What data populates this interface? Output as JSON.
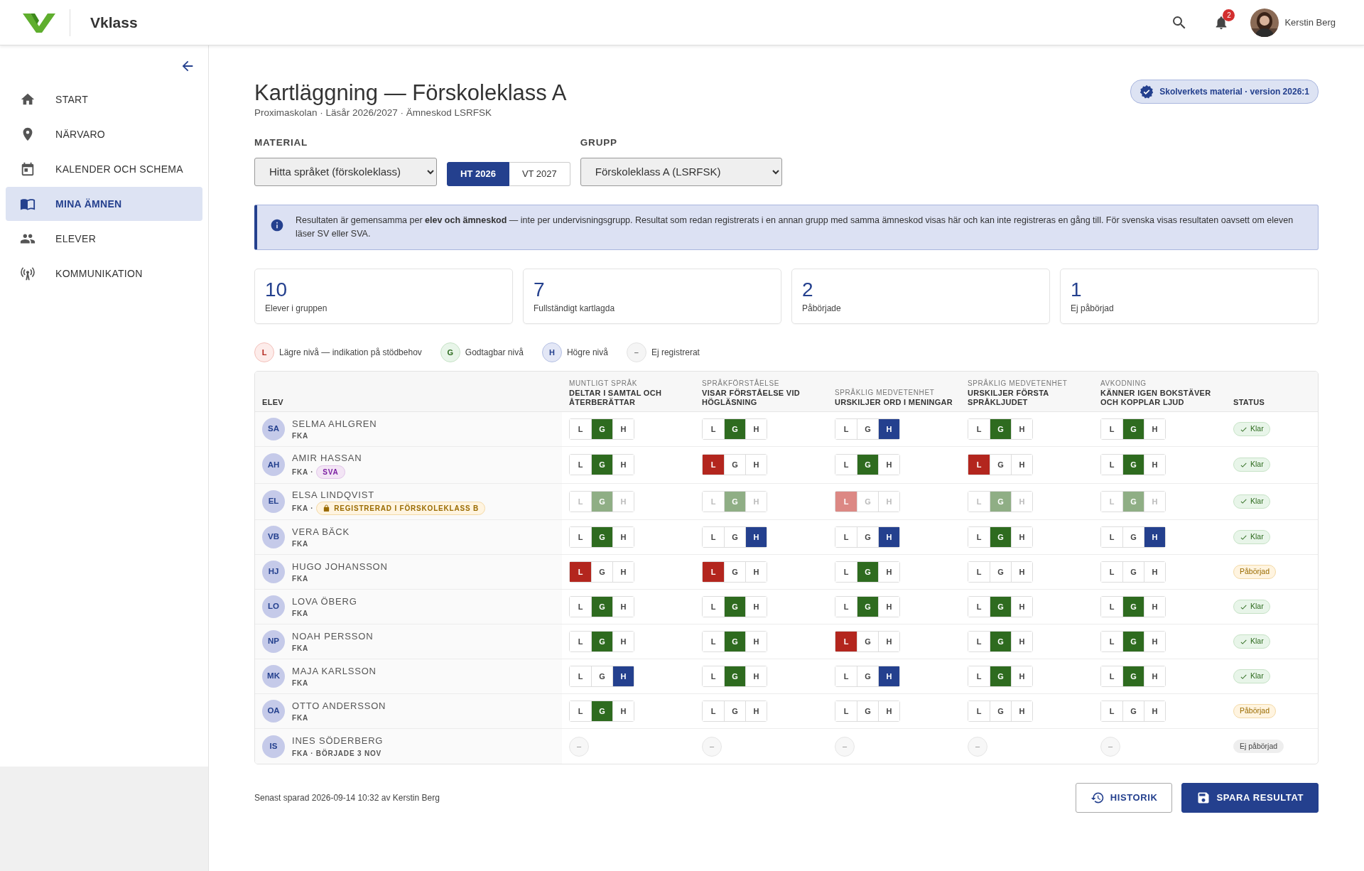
{
  "header": {
    "brand": "Vklass",
    "notifications": "2",
    "user": "Kerstin Berg"
  },
  "sidebar": {
    "items": [
      {
        "label": "START",
        "selected": false
      },
      {
        "label": "NÄRVARO",
        "selected": false
      },
      {
        "label": "KALENDER OCH SCHEMA",
        "selected": false
      },
      {
        "label": "MINA ÄMNEN",
        "selected": true
      },
      {
        "label": "ELEVER",
        "selected": false
      },
      {
        "label": "KOMMUNIKATION",
        "selected": false
      }
    ]
  },
  "page": {
    "title": "Kartläggning — Förskoleklass A",
    "subtitle": "Proximaskolan · Läsår 2026/2027 · Ämneskod LSRFSK",
    "badge": "Skolverkets material · version 2026:1"
  },
  "filters": {
    "material_label": "MATERIAL",
    "material": "Hitta språket (förskoleklass)",
    "terms": [
      {
        "label": "HT 2026",
        "selected": true
      },
      {
        "label": "VT 2027",
        "selected": false
      }
    ],
    "group_label": "GRUPP",
    "group": "Förskoleklass A (LSRFSK)"
  },
  "notice": "Resultaten är gemensamma per **elev och ämneskod** — inte per undervisningsgrupp. Resultat som redan registrerats i en annan grupp med samma ämneskod visas här och kan inte registreras en gång till. För svenska visas resultaten oavsett om eleven läser SV eller SVA.",
  "stats": [
    {
      "value": "10",
      "label": "Elever i gruppen"
    },
    {
      "value": "7",
      "label": "Fullständigt kartlagda"
    },
    {
      "value": "2",
      "label": "Påbörjade"
    },
    {
      "value": "1",
      "label": "Ej påbörjad"
    }
  ],
  "legend": [
    {
      "kind": "low",
      "symbol": "L",
      "text": "Lägre nivå — indikation på stödbehov"
    },
    {
      "kind": "ok",
      "symbol": "G",
      "text": "Godtagbar nivå"
    },
    {
      "kind": "high",
      "symbol": "H",
      "text": "Högre nivå"
    },
    {
      "kind": "none",
      "symbol": "–",
      "text": "Ej registrerat"
    }
  ],
  "table": {
    "columns": [
      {
        "title": "ELEV"
      },
      {
        "area": "MUNTLIGT SPRÅK",
        "title": "DELTAR I SAMTAL OCH ÅTERBERÄTTAR"
      },
      {
        "area": "SPRÅKFÖRSTÅELSE",
        "title": "VISAR FÖRSTÅELSE VID HÖGLÄSNING"
      },
      {
        "area": "SPRÅKLIG MEDVETENHET",
        "title": "URSKILJER ORD I MENINGAR"
      },
      {
        "area": "SPRÅKLIG MEDVETENHET",
        "title": "URSKILJER FÖRSTA SPRÅKLJUDET"
      },
      {
        "area": "AVKODNING",
        "title": "KÄNNER IGEN BOKSTÄVER OCH KOPPLAR LJUD"
      },
      {
        "title": "STATUS"
      }
    ],
    "rows": [
      {
        "initials": "SA",
        "name": "SELMA AHLGREN",
        "meta": "FKA",
        "grades": [
          {
            "options": [
              {
                "label": "L",
                "selected": false
              },
              {
                "label": "G",
                "selected": true
              },
              {
                "label": "H",
                "selected": false
              }
            ]
          },
          {
            "options": [
              {
                "label": "L",
                "selected": false
              },
              {
                "label": "G",
                "selected": true
              },
              {
                "label": "H",
                "selected": false
              }
            ]
          },
          {
            "options": [
              {
                "label": "L",
                "selected": false
              },
              {
                "label": "G",
                "selected": false
              },
              {
                "label": "H",
                "selected": true
              }
            ]
          },
          {
            "options": [
              {
                "label": "L",
                "selected": false
              },
              {
                "label": "G",
                "selected": true
              },
              {
                "label": "H",
                "selected": false
              }
            ]
          },
          {
            "options": [
              {
                "label": "L",
                "selected": false
              },
              {
                "label": "G",
                "selected": true
              },
              {
                "label": "H",
                "selected": false
              }
            ]
          }
        ],
        "status": {
          "kind": "done",
          "text": "Klar"
        }
      },
      {
        "initials": "AH",
        "name": "AMIR HASSAN",
        "meta": "FKA ·",
        "tag": {
          "kind": "sva",
          "text": "SVA"
        },
        "grades": [
          {
            "options": [
              {
                "label": "L",
                "selected": false
              },
              {
                "label": "G",
                "selected": true
              },
              {
                "label": "H",
                "selected": false
              }
            ]
          },
          {
            "options": [
              {
                "label": "L",
                "selected": true
              },
              {
                "label": "G",
                "selected": false
              },
              {
                "label": "H",
                "selected": false
              }
            ]
          },
          {
            "options": [
              {
                "label": "L",
                "selected": false
              },
              {
                "label": "G",
                "selected": true
              },
              {
                "label": "H",
                "selected": false
              }
            ]
          },
          {
            "options": [
              {
                "label": "L",
                "selected": true
              },
              {
                "label": "G",
                "selected": false
              },
              {
                "label": "H",
                "selected": false
              }
            ]
          },
          {
            "options": [
              {
                "label": "L",
                "selected": false
              },
              {
                "label": "G",
                "selected": true
              },
              {
                "label": "H",
                "selected": false
              }
            ]
          }
        ],
        "status": {
          "kind": "done",
          "text": "Klar"
        }
      },
      {
        "initials": "EL",
        "name": "ELSA LINDQVIST",
        "meta": "FKA ·",
        "tag": {
          "kind": "locked",
          "text": "REGISTRERAD I FÖRSKOLEKLASS B"
        },
        "locked": true,
        "grades": [
          {
            "options": [
              {
                "label": "L",
                "selected": false
              },
              {
                "label": "G",
                "selected": true
              },
              {
                "label": "H",
                "selected": false
              }
            ]
          },
          {
            "options": [
              {
                "label": "L",
                "selected": false
              },
              {
                "label": "G",
                "selected": true
              },
              {
                "label": "H",
                "selected": false
              }
            ]
          },
          {
            "options": [
              {
                "label": "L",
                "selected": true
              },
              {
                "label": "G",
                "selected": false
              },
              {
                "label": "H",
                "selected": false
              }
            ]
          },
          {
            "options": [
              {
                "label": "L",
                "selected": false
              },
              {
                "label": "G",
                "selected": true
              },
              {
                "label": "H",
                "selected": false
              }
            ]
          },
          {
            "options": [
              {
                "label": "L",
                "selected": false
              },
              {
                "label": "G",
                "selected": true
              },
              {
                "label": "H",
                "selected": false
              }
            ]
          }
        ],
        "status": {
          "kind": "done",
          "text": "Klar"
        }
      },
      {
        "initials": "VB",
        "name": "VERA BÄCK",
        "meta": "FKA",
        "grades": [
          {
            "options": [
              {
                "label": "L",
                "selected": false
              },
              {
                "label": "G",
                "selected": true
              },
              {
                "label": "H",
                "selected": false
              }
            ]
          },
          {
            "options": [
              {
                "label": "L",
                "selected": false
              },
              {
                "label": "G",
                "selected": false
              },
              {
                "label": "H",
                "selected": true
              }
            ]
          },
          {
            "options": [
              {
                "label": "L",
                "selected": false
              },
              {
                "label": "G",
                "selected": false
              },
              {
                "label": "H",
                "selected": true
              }
            ]
          },
          {
            "options": [
              {
                "label": "L",
                "selected": false
              },
              {
                "label": "G",
                "selected": true
              },
              {
                "label": "H",
                "selected": false
              }
            ]
          },
          {
            "options": [
              {
                "label": "L",
                "selected": false
              },
              {
                "label": "G",
                "selected": false
              },
              {
                "label": "H",
                "selected": true
              }
            ]
          }
        ],
        "status": {
          "kind": "done",
          "text": "Klar"
        }
      },
      {
        "initials": "HJ",
        "name": "HUGO JOHANSSON",
        "meta": "FKA",
        "grades": [
          {
            "options": [
              {
                "label": "L",
                "selected": true
              },
              {
                "label": "G",
                "selected": false
              },
              {
                "label": "H",
                "selected": false
              }
            ]
          },
          {
            "options": [
              {
                "label": "L",
                "selected": true
              },
              {
                "label": "G",
                "selected": false
              },
              {
                "label": "H",
                "selected": false
              }
            ]
          },
          {
            "options": [
              {
                "label": "L",
                "selected": false
              },
              {
                "label": "G",
                "selected": true
              },
              {
                "label": "H",
                "selected": false
              }
            ]
          },
          {
            "options": [
              {
                "label": "L",
                "selected": false
              },
              {
                "label": "G",
                "selected": false
              },
              {
                "label": "H",
                "selected": false
              }
            ]
          },
          {
            "options": [
              {
                "label": "L",
                "selected": false
              },
              {
                "label": "G",
                "selected": false
              },
              {
                "label": "H",
                "selected": false
              }
            ]
          }
        ],
        "status": {
          "kind": "started",
          "text": "Påbörjad"
        }
      },
      {
        "initials": "LO",
        "name": "LOVA ÖBERG",
        "meta": "FKA",
        "grades": [
          {
            "options": [
              {
                "label": "L",
                "selected": false
              },
              {
                "label": "G",
                "selected": true
              },
              {
                "label": "H",
                "selected": false
              }
            ]
          },
          {
            "options": [
              {
                "label": "L",
                "selected": false
              },
              {
                "label": "G",
                "selected": true
              },
              {
                "label": "H",
                "selected": false
              }
            ]
          },
          {
            "options": [
              {
                "label": "L",
                "selected": false
              },
              {
                "label": "G",
                "selected": true
              },
              {
                "label": "H",
                "selected": false
              }
            ]
          },
          {
            "options": [
              {
                "label": "L",
                "selected": false
              },
              {
                "label": "G",
                "selected": true
              },
              {
                "label": "H",
                "selected": false
              }
            ]
          },
          {
            "options": [
              {
                "label": "L",
                "selected": false
              },
              {
                "label": "G",
                "selected": true
              },
              {
                "label": "H",
                "selected": false
              }
            ]
          }
        ],
        "status": {
          "kind": "done",
          "text": "Klar"
        }
      },
      {
        "initials": "NP",
        "name": "NOAH PERSSON",
        "meta": "FKA",
        "grades": [
          {
            "options": [
              {
                "label": "L",
                "selected": false
              },
              {
                "label": "G",
                "selected": true
              },
              {
                "label": "H",
                "selected": false
              }
            ]
          },
          {
            "options": [
              {
                "label": "L",
                "selected": false
              },
              {
                "label": "G",
                "selected": true
              },
              {
                "label": "H",
                "selected": false
              }
            ]
          },
          {
            "options": [
              {
                "label": "L",
                "selected": true
              },
              {
                "label": "G",
                "selected": false
              },
              {
                "label": "H",
                "selected": false
              }
            ]
          },
          {
            "options": [
              {
                "label": "L",
                "selected": false
              },
              {
                "label": "G",
                "selected": true
              },
              {
                "label": "H",
                "selected": false
              }
            ]
          },
          {
            "options": [
              {
                "label": "L",
                "selected": false
              },
              {
                "label": "G",
                "selected": true
              },
              {
                "label": "H",
                "selected": false
              }
            ]
          }
        ],
        "status": {
          "kind": "done",
          "text": "Klar"
        }
      },
      {
        "initials": "MK",
        "name": "MAJA KARLSSON",
        "meta": "FKA",
        "grades": [
          {
            "options": [
              {
                "label": "L",
                "selected": false
              },
              {
                "label": "G",
                "selected": false
              },
              {
                "label": "H",
                "selected": true
              }
            ]
          },
          {
            "options": [
              {
                "label": "L",
                "selected": false
              },
              {
                "label": "G",
                "selected": true
              },
              {
                "label": "H",
                "selected": false
              }
            ]
          },
          {
            "options": [
              {
                "label": "L",
                "selected": false
              },
              {
                "label": "G",
                "selected": false
              },
              {
                "label": "H",
                "selected": true
              }
            ]
          },
          {
            "options": [
              {
                "label": "L",
                "selected": false
              },
              {
                "label": "G",
                "selected": true
              },
              {
                "label": "H",
                "selected": false
              }
            ]
          },
          {
            "options": [
              {
                "label": "L",
                "selected": false
              },
              {
                "label": "G",
                "selected": true
              },
              {
                "label": "H",
                "selected": false
              }
            ]
          }
        ],
        "status": {
          "kind": "done",
          "text": "Klar"
        }
      },
      {
        "initials": "OA",
        "name": "OTTO ANDERSSON",
        "meta": "FKA",
        "grades": [
          {
            "options": [
              {
                "label": "L",
                "selected": false
              },
              {
                "label": "G",
                "selected": true
              },
              {
                "label": "H",
                "selected": false
              }
            ]
          },
          {
            "options": [
              {
                "label": "L",
                "selected": false
              },
              {
                "label": "G",
                "selected": false
              },
              {
                "label": "H",
                "selected": false
              }
            ]
          },
          {
            "options": [
              {
                "label": "L",
                "selected": false
              },
              {
                "label": "G",
                "selected": false
              },
              {
                "label": "H",
                "selected": false
              }
            ]
          },
          {
            "options": [
              {
                "label": "L",
                "selected": false
              },
              {
                "label": "G",
                "selected": false
              },
              {
                "label": "H",
                "selected": false
              }
            ]
          },
          {
            "options": [
              {
                "label": "L",
                "selected": false
              },
              {
                "label": "G",
                "selected": false
              },
              {
                "label": "H",
                "selected": false
              }
            ]
          }
        ],
        "status": {
          "kind": "started",
          "text": "Påbörjad"
        }
      },
      {
        "initials": "IS",
        "name": "INES SÖDERBERG",
        "meta": "FKA · BÖRJADE 3 NOV",
        "grades": [
          {
            "empty": "–"
          },
          {
            "empty": "–"
          },
          {
            "empty": "–"
          },
          {
            "empty": "–"
          },
          {
            "empty": "–"
          }
        ],
        "status": {
          "kind": "none",
          "text": "Ej påbörjad"
        }
      }
    ]
  },
  "footer": {
    "saved": "Senast sparad 2026-09-14 10:32 av Kerstin Berg",
    "buttons": [
      {
        "kind": "outline",
        "label": "HISTORIK"
      },
      {
        "kind": "primary",
        "label": "SPARA RESULTAT"
      }
    ]
  }
}
